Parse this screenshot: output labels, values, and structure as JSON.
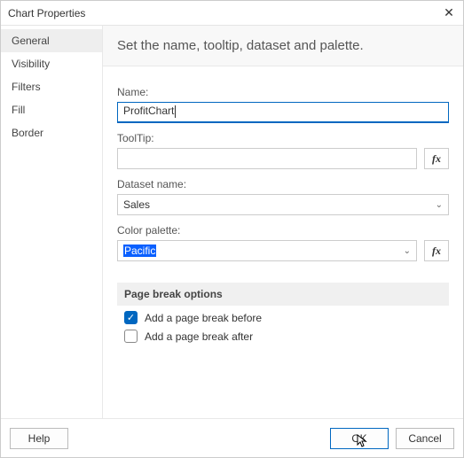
{
  "titlebar": {
    "title": "Chart Properties"
  },
  "sidebar": {
    "items": [
      {
        "label": "General"
      },
      {
        "label": "Visibility"
      },
      {
        "label": "Filters"
      },
      {
        "label": "Fill"
      },
      {
        "label": "Border"
      }
    ]
  },
  "main": {
    "heading": "Set the name, tooltip, dataset and palette.",
    "labels": {
      "name": "Name:",
      "tooltip": "ToolTip:",
      "dataset": "Dataset name:",
      "palette": "Color palette:"
    },
    "values": {
      "name": "ProfitChart",
      "tooltip": "",
      "dataset": "Sales",
      "palette": "Pacific"
    },
    "fx_label": "fx",
    "section_header": "Page break options",
    "checks": {
      "before": {
        "label": "Add a page break before",
        "checked": true
      },
      "after": {
        "label": "Add a page break after",
        "checked": false
      }
    }
  },
  "footer": {
    "help": "Help",
    "ok": "OK",
    "cancel": "Cancel"
  },
  "icons": {
    "check": "✓",
    "chevron": "⌄",
    "close": "✕"
  }
}
